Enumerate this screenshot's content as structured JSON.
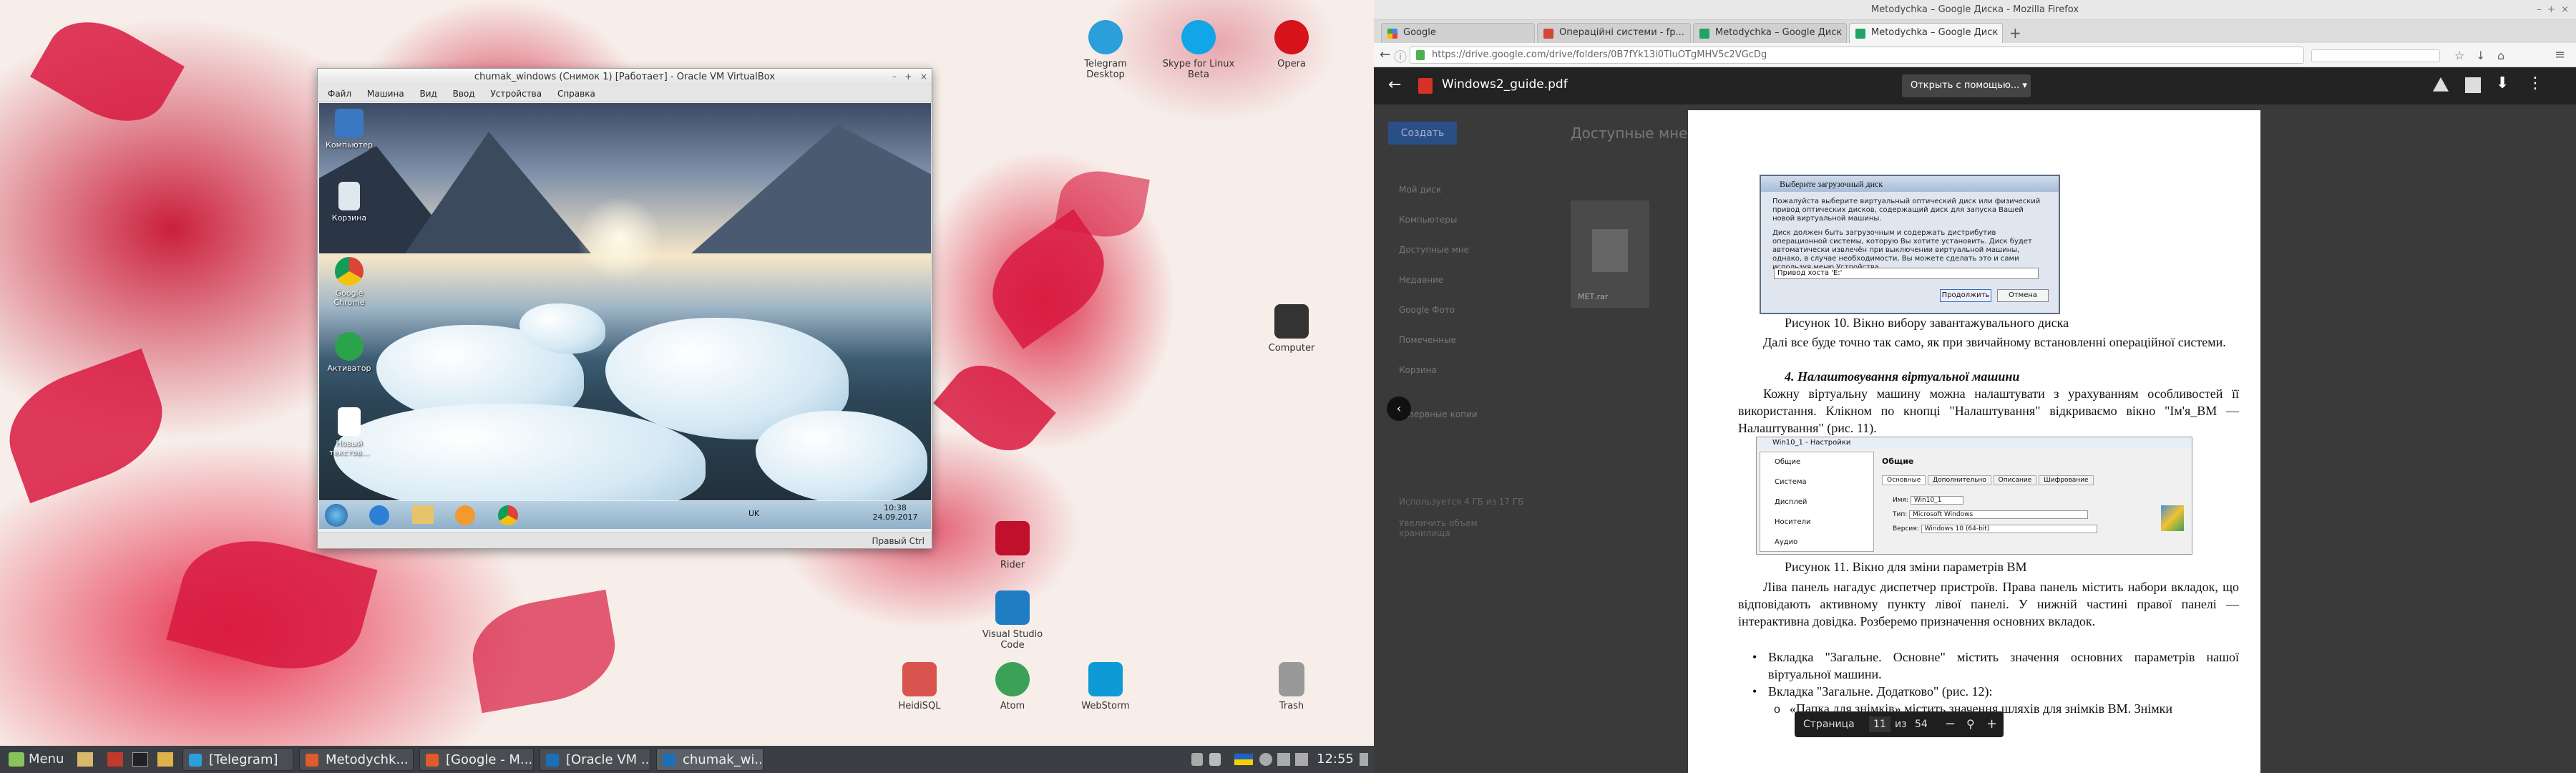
{
  "desktop": {
    "icons": [
      {
        "label": "Telegram Desktop",
        "color": "#2b9fd9"
      },
      {
        "label": "Skype for Linux Beta",
        "color": "#12a5e8"
      },
      {
        "label": "Opera",
        "color": "#d6131b"
      },
      {
        "label": "Computer",
        "color": "#333"
      },
      {
        "label": "Rider",
        "color": "#c0102c"
      },
      {
        "label": "Visual Studio Code",
        "color": "#1f7dc4"
      },
      {
        "label": "HeidiSQL",
        "color": "#d9534f"
      },
      {
        "label": "Atom",
        "color": "#3aa156"
      },
      {
        "label": "WebStorm",
        "color": "#0d9ad5"
      },
      {
        "label": "Trash",
        "color": "#999"
      }
    ]
  },
  "vbox": {
    "title": "chumak_windows (Снимок 1) [Работает] - Oracle VM VirtualBox",
    "menu": [
      "Файл",
      "Машина",
      "Вид",
      "Ввод",
      "Устройства",
      "Справка"
    ],
    "guest_icons": [
      "Компьютер",
      "Корзина",
      "Google Chrome",
      "Активатор",
      "Новый текстов..."
    ],
    "guest_tray_lang": "UK",
    "guest_time": "10:38",
    "guest_date": "24.09.2017",
    "status_right": "Правый Ctrl"
  },
  "taskbar": {
    "menu": "Menu",
    "windows": [
      "[Telegram]",
      "Metodychk...",
      "[Google - M...",
      "[Oracle VM ...",
      "chumak_wi..."
    ],
    "time": "12:55"
  },
  "firefox": {
    "window_title": "Metodychka – Google Диска - Mozilla Firefox",
    "tabs": [
      "Google",
      "Операційні системи - fp...",
      "Metodychka – Google Диск",
      "Metodychka – Google Диск"
    ],
    "url": "https://drive.google.com/drive/folders/0B7fYk13i0TluOTgMHV5c2VGcDg",
    "pdf_name": "Windows2_guide.pdf",
    "open_with": "Открыть с помощью...",
    "drive_button": "Создать",
    "drive_heading": "Доступные мне",
    "drive_sidebar": [
      "Мой диск",
      "Компьютеры",
      "Доступные мне",
      "Недавние",
      "Google Фото",
      "Помеченные",
      "Корзина",
      "Резервные копии"
    ],
    "drive_storage": "Используется 4 ГБ из 17 ГБ",
    "drive_upgrade": "Увеличить объем хранилища",
    "drive_file": "МЕТ.rar",
    "page": {
      "dialog1_title": "Выберите загрузочный диск",
      "dialog1_text": "Пожалуйста выберите виртуальный оптический диск или физический привод оптических дисков, содержащий диск для запуска Вашей новой виртуальной машины.",
      "dialog1_text2": "Диск должен быть загрузочным и содержать дистрибутив операционной системы, которую Вы хотите установить. Диск будет автоматически извлечён при выключении виртуальной машины, однако, в случае необходимости, Вы можете сделать это и сами используя меню Устройства.",
      "dialog1_select": "Привод хоста 'E:'",
      "dialog1_ok": "Продолжить",
      "dialog1_cancel": "Отмена",
      "caption10": "Рисунок 10. Вікно вибору завантажувального диска",
      "para1": "Далі все буде точно так само, як при звичайному встановленні операційної системи.",
      "heading4": "4. Налаштовування віртуальної машини",
      "para2": "Кожну віртуальну машину можна налаштувати з урахуванням особливостей її використання. Клікном по кнопці \"Налаштування\" відкриваємо вікно \"Ім'я_ВМ — Налаштування\" (рис. 11).",
      "dialog2_title": "Win10_1 - Настройки",
      "dialog2_sidebar": [
        "Общие",
        "Система",
        "Дисплей",
        "Носители",
        "Аудио"
      ],
      "dialog2_header": "Общие",
      "dialog2_tabs": [
        "Основные",
        "Дополнительно",
        "Описание",
        "Шифрование"
      ],
      "dialog2_name_label": "Имя:",
      "dialog2_name": "Win10_1",
      "dialog2_type_label": "Тип:",
      "dialog2_type": "Microsoft Windows",
      "dialog2_ver_label": "Версия:",
      "dialog2_ver": "Windows 10 (64-bit)",
      "caption11": "Рисунок 11. Вікно для зміни параметрів ВМ",
      "para3": "Ліва панель нагадує диспетчер пристроїв. Права панель містить набори вкладок, що відповідають активному пункту лівої панелі. У нижній частині правої панелі — інтерактивна довідка. Розберемо призначення основних вкладок.",
      "bullet1": "Вкладка \"Загальне. Основне\" містить значення основних параметрів нашої віртуальної машини.",
      "bullet2": "Вкладка \"Загальне. Додатково\" (рис. 12):",
      "bullet3": "«Папка для знімків» містить значення шляхів для знімків ВМ. Знімки"
    },
    "pager": {
      "label": "Страница",
      "current": "11",
      "of": "из",
      "total": "54"
    }
  }
}
